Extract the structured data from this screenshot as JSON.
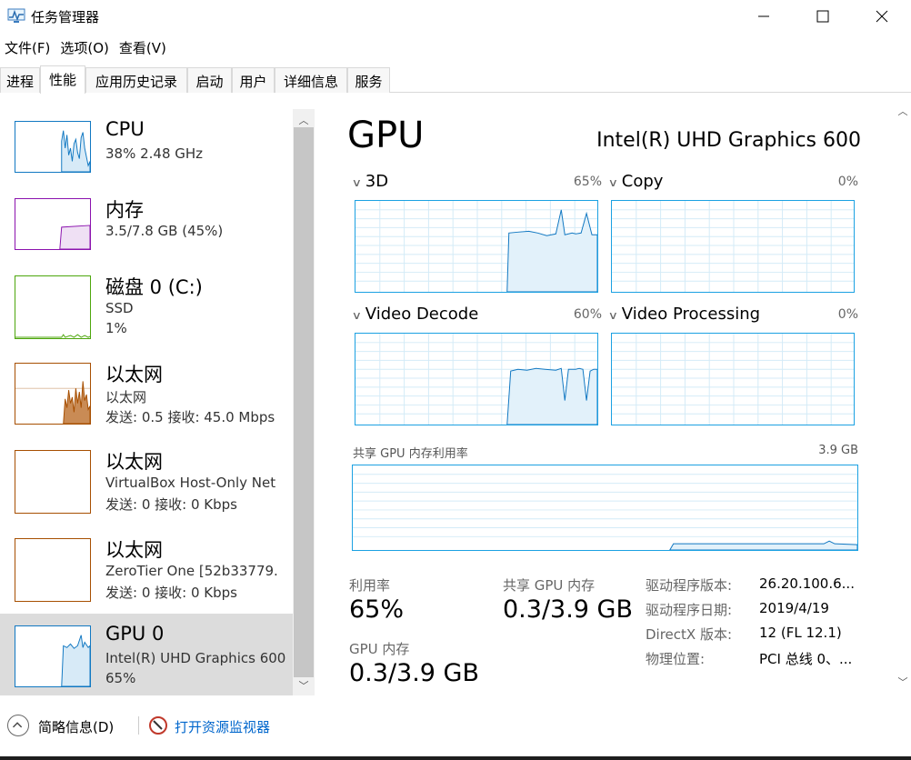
{
  "window": {
    "title": "任务管理器"
  },
  "menu": [
    "文件(F)",
    "选项(O)",
    "查看(V)"
  ],
  "tabs": [
    "进程",
    "性能",
    "应用历史记录",
    "启动",
    "用户",
    "详细信息",
    "服务"
  ],
  "sidebar": {
    "items": [
      {
        "title": "CPU",
        "line1": "38% 2.48 GHz",
        "line2": "",
        "color": "#1178c2"
      },
      {
        "title": "内存",
        "line1": "3.5/7.8 GB (45%)",
        "line2": "",
        "color": "#8b12ae"
      },
      {
        "title": "磁盘 0 (C:)",
        "line1": "SSD",
        "line2": "1%",
        "color": "#4da60c"
      },
      {
        "title": "以太网",
        "line1": "以太网",
        "line2": "发送: 0.5 接收: 45.0 Mbps",
        "color": "#a74f01"
      },
      {
        "title": "以太网",
        "line1": "VirtualBox Host-Only Net",
        "line2": "发送: 0 接收: 0 Kbps",
        "color": "#a74f01"
      },
      {
        "title": "以太网",
        "line1": "ZeroTier One [52b33779.",
        "line2": "发送: 0 接收: 0 Kbps",
        "color": "#a74f01"
      },
      {
        "title": "GPU 0",
        "line1": "Intel(R) UHD Graphics 600",
        "line2": "65%",
        "color": "#1178c2"
      }
    ]
  },
  "gpu": {
    "title": "GPU",
    "model": "Intel(R) UHD Graphics 600",
    "graphs": [
      {
        "label": "3D",
        "percent": "65%"
      },
      {
        "label": "Copy",
        "percent": "0%"
      },
      {
        "label": "Video Decode",
        "percent": "60%"
      },
      {
        "label": "Video Processing",
        "percent": "0%"
      }
    ],
    "shared_memory_graph": {
      "label": "共享 GPU 内存利用率",
      "max": "3.9 GB"
    },
    "stats": {
      "utilization_label": "利用率",
      "utilization_value": "65%",
      "shared_mem_label": "共享 GPU 内存",
      "shared_mem_value": "0.3/3.9 GB",
      "gpu_mem_label": "GPU 内存",
      "gpu_mem_value": "0.3/3.9 GB"
    },
    "info": [
      {
        "label": "驱动程序版本:",
        "value": "26.20.100.6..."
      },
      {
        "label": "驱动程序日期:",
        "value": "2019/4/19"
      },
      {
        "label": "DirectX 版本:",
        "value": "12 (FL 12.1)"
      },
      {
        "label": "物理位置:",
        "value": "PCI 总线 0、..."
      }
    ]
  },
  "footer": {
    "fewer_details": "简略信息(D)",
    "resource_monitor": "打开资源监视器"
  },
  "colors": {
    "accent": "#1ba1e2",
    "selected": "#dcdcdc"
  }
}
